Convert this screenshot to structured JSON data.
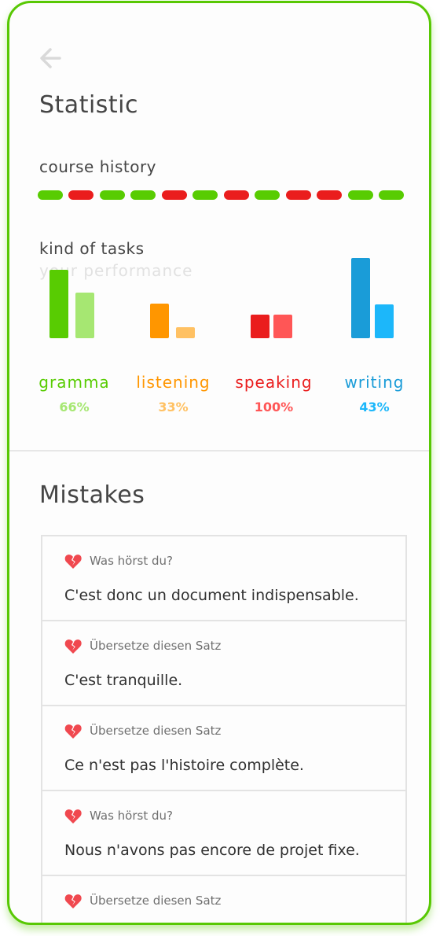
{
  "header": {
    "title": "Statistic"
  },
  "history": {
    "label": "course history",
    "results": [
      "ok",
      "fail",
      "ok",
      "ok",
      "fail",
      "ok",
      "fail",
      "ok",
      "fail",
      "fail",
      "ok",
      "ok"
    ],
    "colors": {
      "ok": "#58cc02",
      "fail": "#ea1d1d"
    }
  },
  "tasks": {
    "label": "kind of tasks",
    "sublabel": "your performance",
    "items": [
      {
        "name": "gramma",
        "percent": "66%",
        "color": "#58cc02",
        "light": "#a6e772"
      },
      {
        "name": "listening",
        "percent": "33%",
        "color": "#ff9600",
        "light": "#ffc163"
      },
      {
        "name": "speaking",
        "percent": "100%",
        "color": "#ea1d1d",
        "light": "#ff5656"
      },
      {
        "name": "writing",
        "percent": "43%",
        "color": "#1a9cd8",
        "light": "#1cb7fa"
      }
    ],
    "bar_levels": [
      [
        0.85,
        0.57
      ],
      [
        0.43,
        0.14
      ],
      [
        0.29,
        0.29
      ],
      [
        1.0,
        0.42
      ]
    ]
  },
  "mistakes": {
    "title": "Mistakes",
    "items": [
      {
        "prompt": "Was hörst du?",
        "sentence": "C'est donc un document indispensable."
      },
      {
        "prompt": "Übersetze diesen Satz",
        "sentence": "C'est tranquille."
      },
      {
        "prompt": "Übersetze diesen Satz",
        "sentence": "Ce n'est pas l'histoire complète."
      },
      {
        "prompt": "Was hörst du?",
        "sentence": "Nous n'avons pas encore de projet fixe."
      },
      {
        "prompt": "Übersetze diesen Satz",
        "sentence": ""
      }
    ],
    "heart_icon": "broken-heart-icon",
    "heart_color": "#f0484f"
  }
}
